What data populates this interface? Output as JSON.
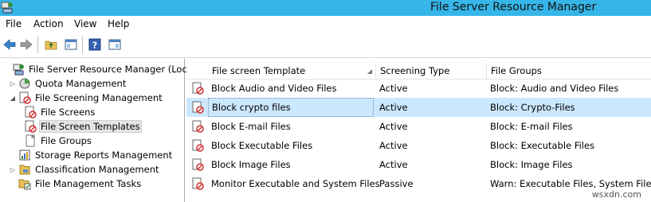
{
  "window": {
    "title": "File Server Resource Manager"
  },
  "menu": [
    "File",
    "Action",
    "View",
    "Help"
  ],
  "toolbar": {
    "icons": [
      "back-arrow-icon",
      "forward-arrow-icon",
      "up-folder-icon",
      "show-hide-console-tree-icon",
      "help-icon",
      "action-pane-icon"
    ]
  },
  "tree": {
    "items": [
      {
        "label": "File Server Resource Manager (Local)",
        "icon": "fsrm-icon",
        "expander": "",
        "indent": 0
      },
      {
        "label": "Quota Management",
        "icon": "quota-icon",
        "expander": "collapsed",
        "indent": 1
      },
      {
        "label": "File Screening Management",
        "icon": "file-screening-icon",
        "expander": "expanded",
        "indent": 1
      },
      {
        "label": "File Screens",
        "icon": "file-screen-icon",
        "expander": "",
        "indent": 2
      },
      {
        "label": "File Screen Templates",
        "icon": "file-screen-template-icon",
        "expander": "",
        "indent": 2,
        "selected": true
      },
      {
        "label": "File Groups",
        "icon": "file-group-icon",
        "expander": "",
        "indent": 2
      },
      {
        "label": "Storage Reports Management",
        "icon": "storage-reports-icon",
        "expander": "",
        "indent": 1
      },
      {
        "label": "Classification Management",
        "icon": "classification-icon",
        "expander": "collapsed",
        "indent": 1
      },
      {
        "label": "File Management Tasks",
        "icon": "file-management-tasks-icon",
        "expander": "",
        "indent": 1
      }
    ]
  },
  "list": {
    "columns": [
      "File screen Template",
      "Screening Type",
      "File Groups"
    ],
    "rows": [
      {
        "template": "Block Audio and Video Files",
        "type": "Active",
        "groups": "Block: Audio and Video Files"
      },
      {
        "template": "Block crypto files",
        "type": "Active",
        "groups": "Block: Crypto-Files",
        "selected": true
      },
      {
        "template": "Block E-mail Files",
        "type": "Active",
        "groups": "Block: E-mail Files"
      },
      {
        "template": "Block Executable Files",
        "type": "Active",
        "groups": "Block: Executable Files"
      },
      {
        "template": "Block Image Files",
        "type": "Active",
        "groups": "Block: Image Files"
      },
      {
        "template": "Monitor Executable and System Files",
        "type": "Passive",
        "groups": "Warn: Executable Files, System Files"
      }
    ]
  },
  "watermark": "wsxdn.com",
  "colors": {
    "titlebar": "#36b6e8",
    "selection": "#cce8ff",
    "tree_selection": "#e5e5e5"
  }
}
